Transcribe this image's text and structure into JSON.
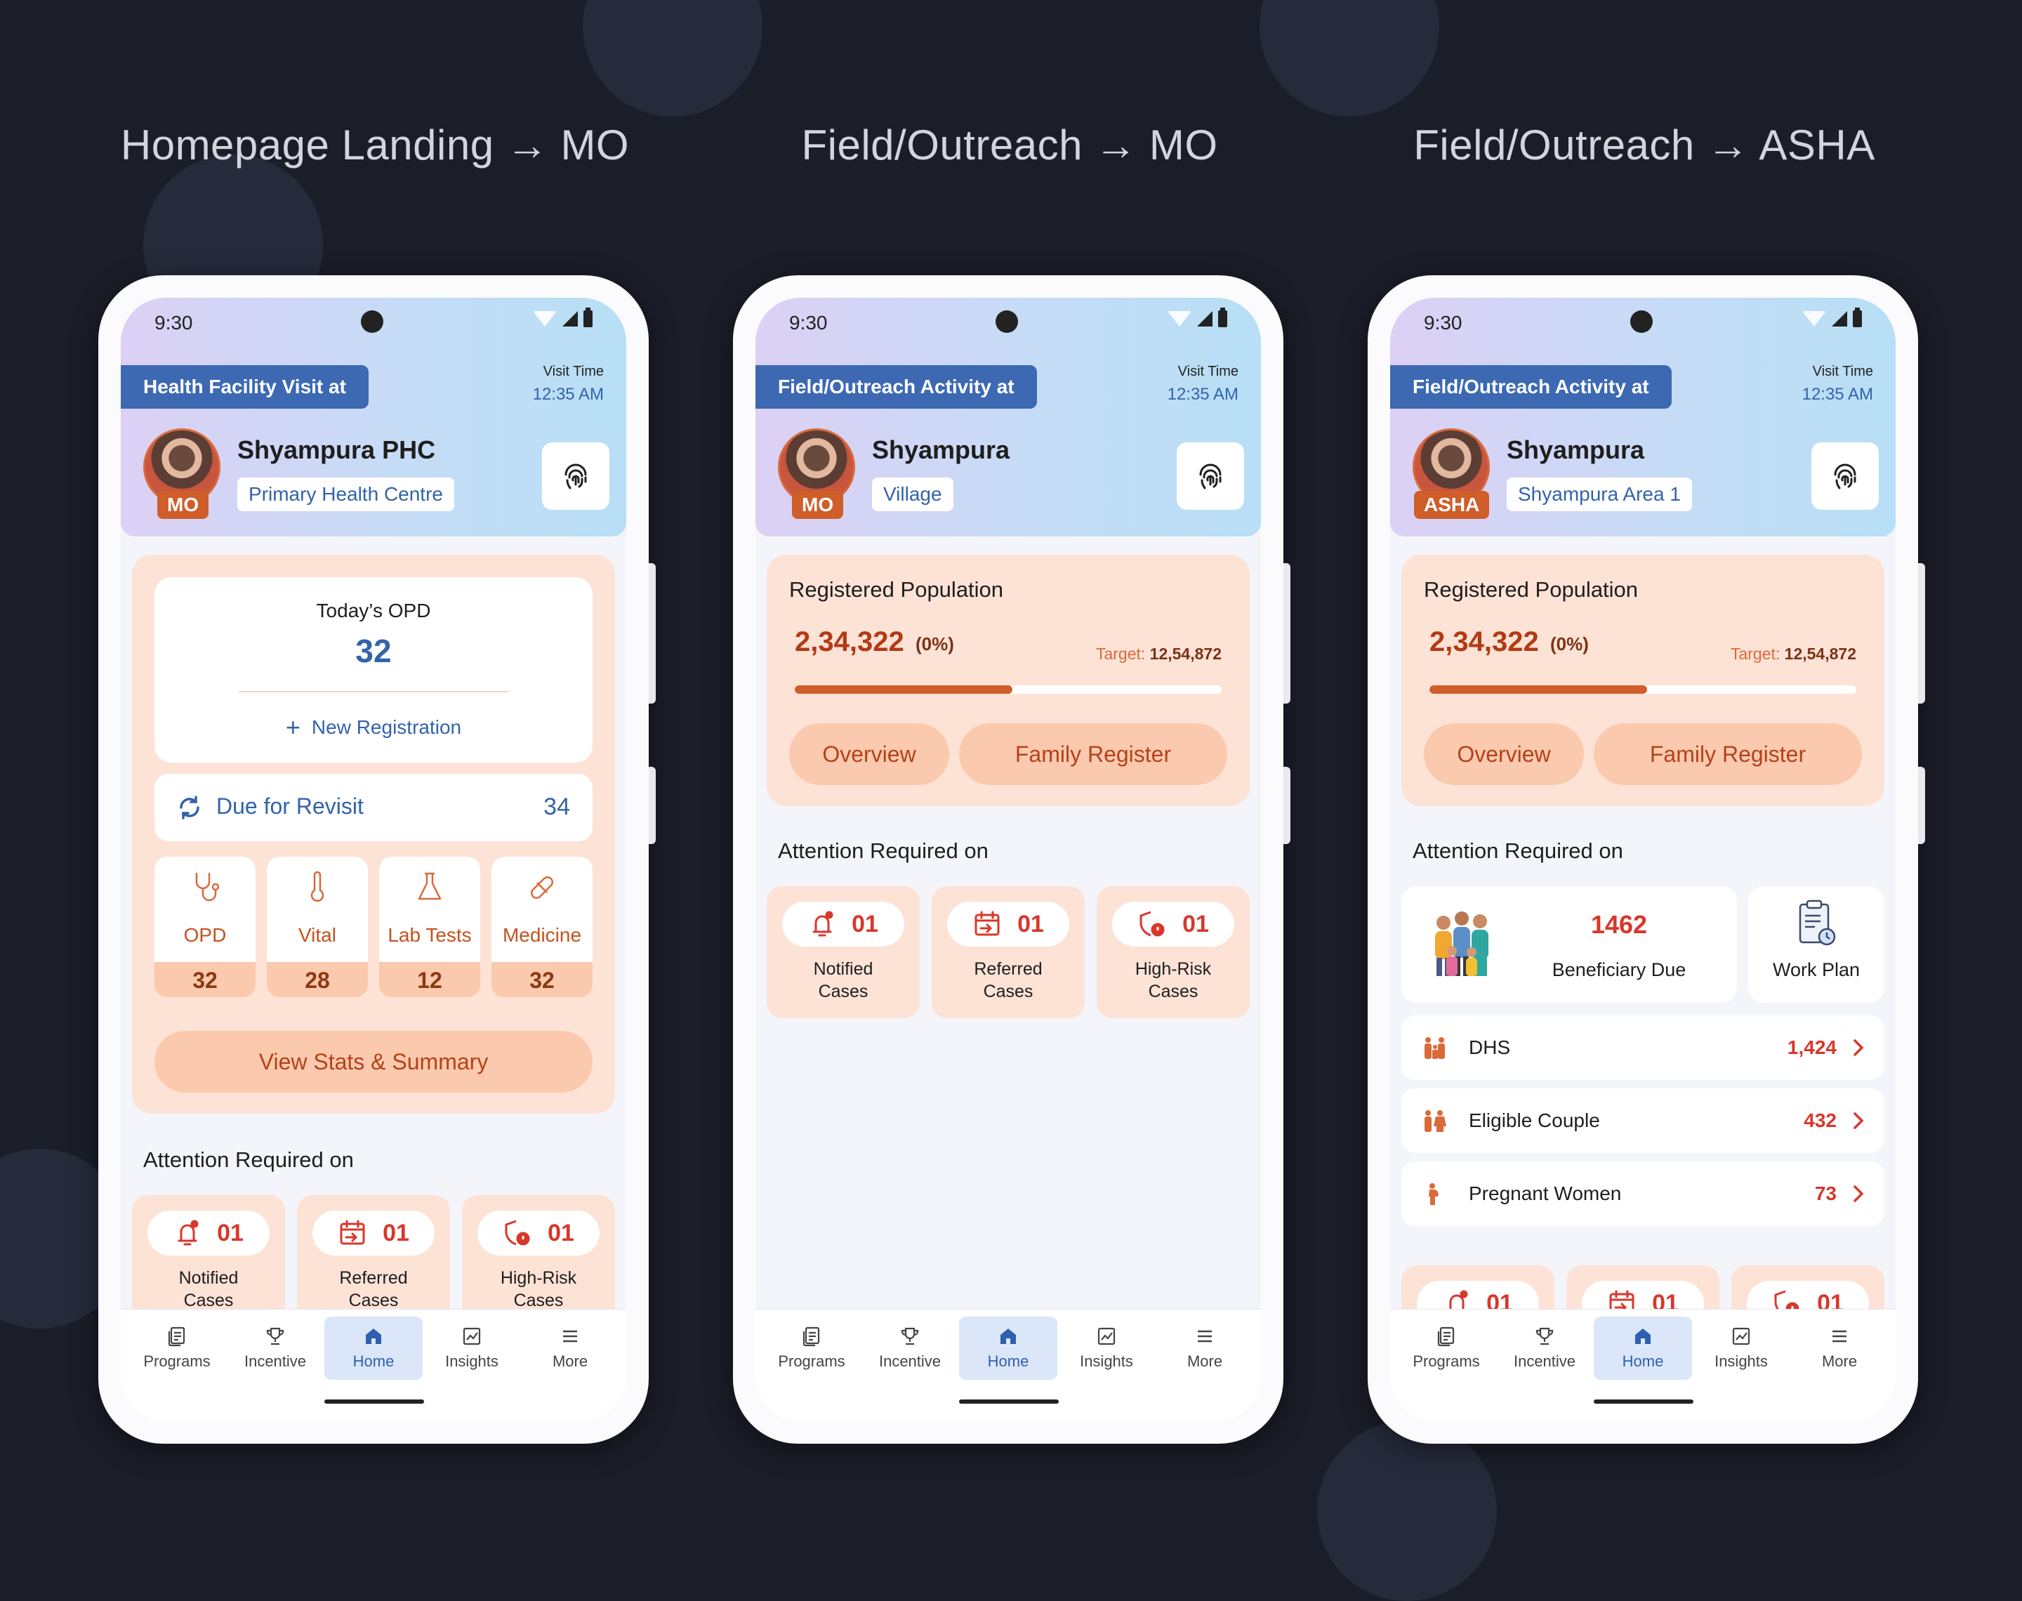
{
  "columns": [
    {
      "title": "Homepage Landing → MO"
    },
    {
      "title": "Field/Outreach → MO"
    },
    {
      "title": "Field/Outreach → ASHA"
    }
  ],
  "status": {
    "time": "9:30"
  },
  "phones": [
    {
      "visit_tag": "Health Facility Visit at",
      "visit_time_label": "Visit Time",
      "visit_time": "12:35 AM",
      "place_name": "Shyampura PHC",
      "place_type": "Primary Health Centre",
      "role": "MO",
      "opd": {
        "title": "Today’s OPD",
        "value": "32",
        "new_registration": "New Registration"
      },
      "revisit": {
        "label": "Due for Revisit",
        "value": "34"
      },
      "tiles": [
        {
          "label": "OPD",
          "value": "32",
          "icon": "stethoscope-icon"
        },
        {
          "label": "Vital",
          "value": "28",
          "icon": "thermometer-icon"
        },
        {
          "label": "Lab Tests",
          "value": "12",
          "icon": "flask-icon"
        },
        {
          "label": "Medicine",
          "value": "32",
          "icon": "pill-icon"
        }
      ],
      "view_stats": "View Stats & Summary",
      "attention_title": "Attention Required on",
      "attention": [
        {
          "count": "01",
          "label1": "Notified",
          "label2": "Cases",
          "icon": "bell-icon"
        },
        {
          "count": "01",
          "label1": "Referred",
          "label2": "Cases",
          "icon": "calendar-referral-icon"
        },
        {
          "count": "01",
          "label1": "High-Risk",
          "label2": "Cases",
          "icon": "risk-shield-icon"
        }
      ]
    },
    {
      "visit_tag": "Field/Outreach Activity at",
      "visit_time_label": "Visit Time",
      "visit_time": "12:35 AM",
      "place_name": "Shyampura",
      "place_type": "Village",
      "role": "MO",
      "population": {
        "title": "Registered Population",
        "value": "2,34,322",
        "percent": "(0%)",
        "target_label": "Target:",
        "target_value": "12,54,872",
        "progress": 0.51
      },
      "overview": "Overview",
      "family_register": "Family Register",
      "attention_title": "Attention Required on",
      "attention": [
        {
          "count": "01",
          "label1": "Notified",
          "label2": "Cases",
          "icon": "bell-icon"
        },
        {
          "count": "01",
          "label1": "Referred",
          "label2": "Cases",
          "icon": "calendar-referral-icon"
        },
        {
          "count": "01",
          "label1": "High-Risk",
          "label2": "Cases",
          "icon": "risk-shield-icon"
        }
      ]
    },
    {
      "visit_tag": "Field/Outreach Activity at",
      "visit_time_label": "Visit Time",
      "visit_time": "12:35 AM",
      "place_name": "Shyampura",
      "place_type": "Shyampura Area 1",
      "role": "ASHA",
      "population": {
        "title": "Registered Population",
        "value": "2,34,322",
        "percent": "(0%)",
        "target_label": "Target:",
        "target_value": "12,54,872",
        "progress": 0.51
      },
      "overview": "Overview",
      "family_register": "Family Register",
      "attention_title": "Attention Required on",
      "beneficiary": {
        "value": "1462",
        "label": "Beneficiary Due"
      },
      "work_plan": "Work Plan",
      "list": [
        {
          "label": "DHS",
          "value": "1,424",
          "icon": "family-icon"
        },
        {
          "label": "Eligible Couple",
          "value": "432",
          "icon": "couple-icon"
        },
        {
          "label": "Pregnant Women",
          "value": "73",
          "icon": "pregnant-woman-icon"
        }
      ],
      "attention": [
        {
          "count": "01",
          "icon": "bell-icon"
        },
        {
          "count": "01",
          "icon": "calendar-referral-icon"
        },
        {
          "count": "01",
          "icon": "risk-shield-icon"
        }
      ]
    }
  ],
  "nav": [
    "Programs",
    "Incentive",
    "Home",
    "Insights",
    "More"
  ],
  "colors": {
    "background": "#1b1d28",
    "accent_blue": "#3d69b3",
    "accent_orange": "#cf5e2b",
    "peach": "#fde2d6",
    "alert_red": "#d9372b"
  }
}
